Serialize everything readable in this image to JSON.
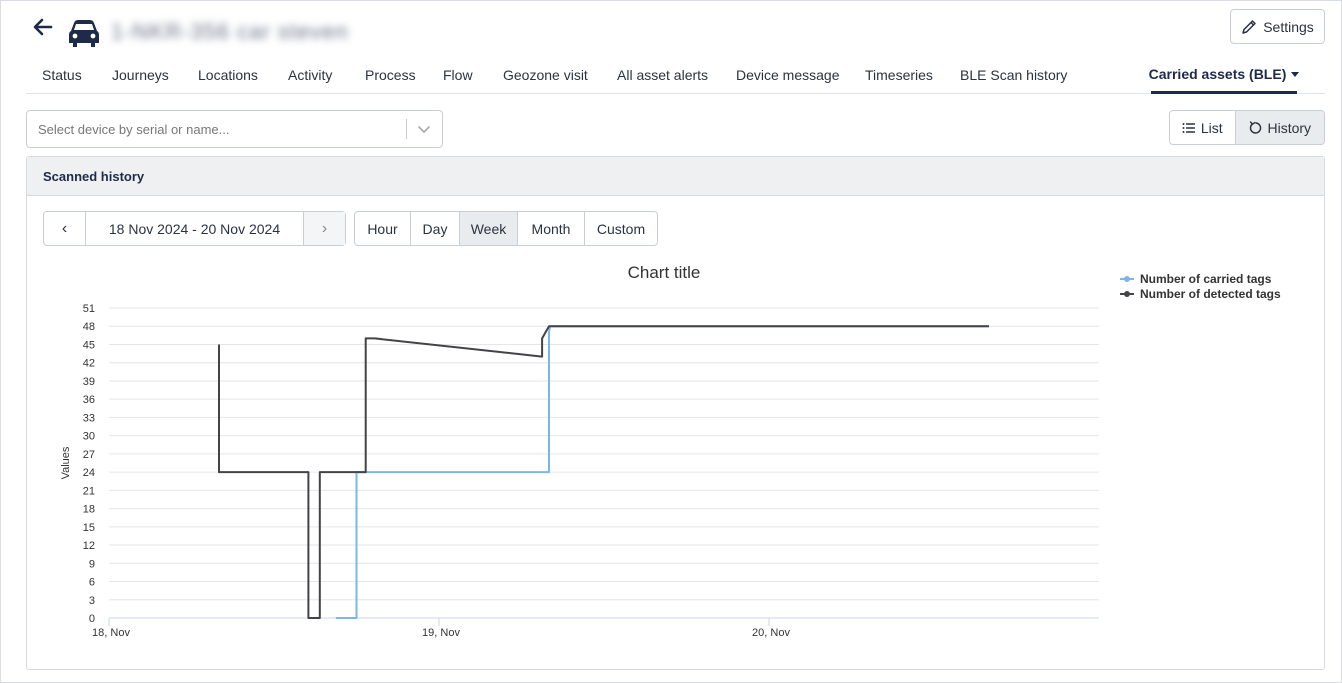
{
  "header": {
    "asset_name": "1-NKR-356 car steven",
    "back_icon": "arrow-left-icon",
    "asset_icon": "car-icon",
    "settings_label": "Settings"
  },
  "tabs": [
    {
      "label": "Status"
    },
    {
      "label": "Journeys"
    },
    {
      "label": "Locations"
    },
    {
      "label": "Activity"
    },
    {
      "label": "Process"
    },
    {
      "label": "Flow"
    },
    {
      "label": "Geozone visit"
    },
    {
      "label": "All asset alerts"
    },
    {
      "label": "Device message"
    },
    {
      "label": "Timeseries"
    },
    {
      "label": "BLE Scan history"
    },
    {
      "label": "Carried assets (BLE)",
      "active": true
    }
  ],
  "device_select": {
    "placeholder": "Select device by serial or name..."
  },
  "view_toggle": {
    "list_label": "List",
    "history_label": "History",
    "selected": "History"
  },
  "panel": {
    "title": "Scanned history"
  },
  "date_nav": {
    "prev": "‹",
    "next": "›",
    "range": "18 Nov 2024 - 20 Nov 2024"
  },
  "period": {
    "options": [
      "Hour",
      "Day",
      "Week",
      "Month",
      "Custom"
    ],
    "selected": "Week"
  },
  "chart_data": {
    "type": "line",
    "title": "Chart title",
    "ylabel": "Values",
    "xlabel": "",
    "ylim": [
      0,
      51
    ],
    "y_ticks": [
      0,
      3,
      6,
      9,
      12,
      15,
      18,
      21,
      24,
      27,
      30,
      33,
      36,
      39,
      42,
      45,
      48,
      51
    ],
    "x_range": [
      "2024-11-18T00:00",
      "2024-11-21T00:00"
    ],
    "x_ticks": [
      {
        "at": "2024-11-18T00:00",
        "label": "18, Nov"
      },
      {
        "at": "2024-11-19T00:00",
        "label": "19, Nov"
      },
      {
        "at": "2024-11-20T00:00",
        "label": "20, Nov"
      }
    ],
    "grid": true,
    "legend_position": "top-right",
    "series": [
      {
        "name": "Number of carried tags",
        "color": "#7cb5ec",
        "points": [
          [
            "2024-11-18T16:30",
            0
          ],
          [
            "2024-11-18T18:00",
            0
          ],
          [
            "2024-11-18T18:00",
            24
          ],
          [
            "2024-11-19T08:00",
            24
          ],
          [
            "2024-11-19T08:00",
            47
          ],
          [
            "2024-11-19T08:05",
            48
          ],
          [
            "2024-11-20T16:00",
            48
          ]
        ]
      },
      {
        "name": "Number of detected tags",
        "color": "#434348",
        "points": [
          [
            "2024-11-18T08:00",
            45
          ],
          [
            "2024-11-18T08:00",
            24
          ],
          [
            "2024-11-18T14:30",
            24
          ],
          [
            "2024-11-18T14:30",
            0
          ],
          [
            "2024-11-18T15:20",
            0
          ],
          [
            "2024-11-18T15:20",
            24
          ],
          [
            "2024-11-18T18:40",
            24
          ],
          [
            "2024-11-18T18:40",
            46
          ],
          [
            "2024-11-18T19:20",
            46
          ],
          [
            "2024-11-19T07:30",
            43
          ],
          [
            "2024-11-19T07:30",
            46
          ],
          [
            "2024-11-19T08:00",
            48
          ],
          [
            "2024-11-20T16:00",
            48
          ]
        ]
      }
    ]
  }
}
